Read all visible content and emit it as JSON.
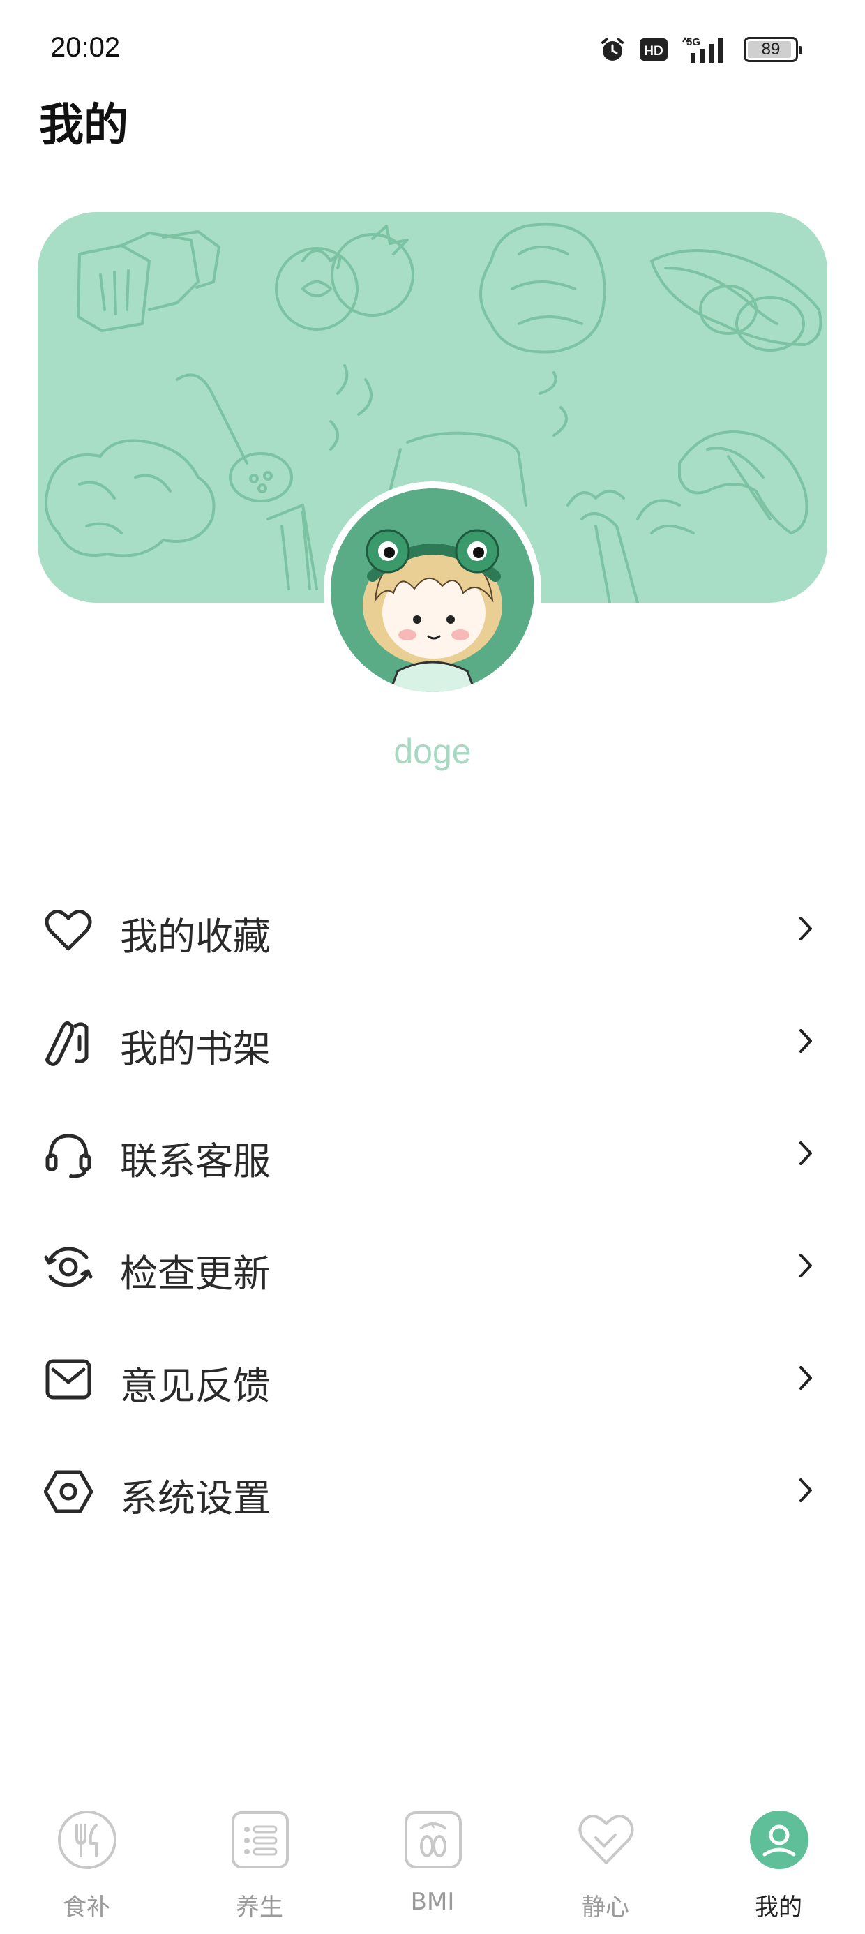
{
  "status_bar": {
    "time": "20:02",
    "hd_label": "HD",
    "network_label": "5G",
    "battery": "89",
    "icons": [
      "alarm-icon",
      "hd-icon",
      "5g-signal-icon",
      "battery-icon"
    ]
  },
  "header": {
    "title": "我的"
  },
  "profile": {
    "username": "doge",
    "banner_color": "#a8dec6",
    "avatar_bg": "#5aac87"
  },
  "menu": {
    "items": [
      {
        "label": "我的收藏",
        "icon": "heart-icon"
      },
      {
        "label": "我的书架",
        "icon": "bookshelf-icon"
      },
      {
        "label": "联系客服",
        "icon": "headset-icon"
      },
      {
        "label": "检查更新",
        "icon": "refresh-eye-icon"
      },
      {
        "label": "意见反馈",
        "icon": "mail-icon"
      },
      {
        "label": "系统设置",
        "icon": "hexagon-settings-icon"
      }
    ],
    "chevron": "chevron-right-icon"
  },
  "tabbar": {
    "tabs": [
      {
        "label": "食补",
        "icon": "utensils-icon",
        "active": false
      },
      {
        "label": "养生",
        "icon": "list-icon",
        "active": false
      },
      {
        "label": "BMI",
        "icon": "scale-icon",
        "active": false
      },
      {
        "label": "静心",
        "icon": "heart-pulse-icon",
        "active": false
      },
      {
        "label": "我的",
        "icon": "user-icon",
        "active": true
      }
    ],
    "active_color": "#5fbf98",
    "inactive_color": "#9a9a9a"
  }
}
